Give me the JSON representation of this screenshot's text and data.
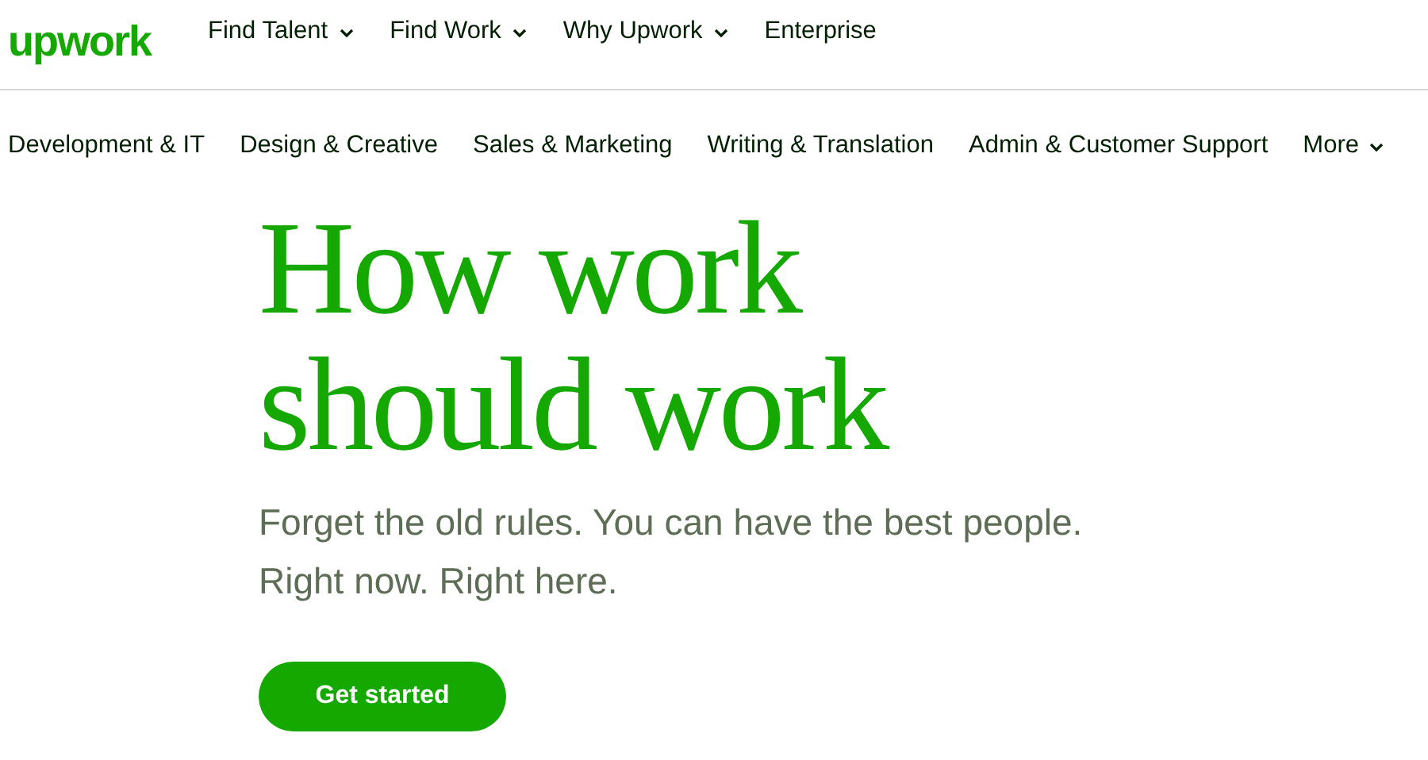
{
  "logo": "upwork",
  "nav": [
    {
      "label": "Find Talent",
      "has_menu": true
    },
    {
      "label": "Find Work",
      "has_menu": true
    },
    {
      "label": "Why Upwork",
      "has_menu": true
    },
    {
      "label": "Enterprise",
      "has_menu": false
    }
  ],
  "categories": [
    {
      "label": "Development & IT",
      "has_menu": false
    },
    {
      "label": "Design & Creative",
      "has_menu": false
    },
    {
      "label": "Sales & Marketing",
      "has_menu": false
    },
    {
      "label": "Writing & Translation",
      "has_menu": false
    },
    {
      "label": "Admin & Customer Support",
      "has_menu": false
    },
    {
      "label": "More",
      "has_menu": true
    }
  ],
  "hero": {
    "headline": [
      "How work",
      "should work"
    ],
    "subtitle": [
      "Forget the old rules. You can have the best people.",
      "Right now. Right here."
    ],
    "button": "Get started"
  }
}
